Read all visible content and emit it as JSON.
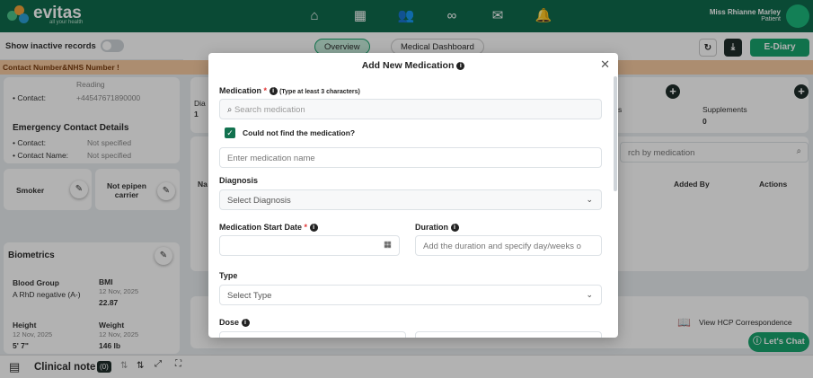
{
  "header": {
    "logo_text": "evitas",
    "logo_tagline": "all your health",
    "user_name": "Miss Rhianne Marley",
    "user_role": "Patient",
    "nav_icons": [
      "home-icon",
      "calendar-icon",
      "people-icon",
      "link-icon",
      "mail-icon",
      "bell-icon"
    ]
  },
  "left": {
    "show_inactive_label": "Show inactive records",
    "banner": "Contact Number&NHS Number !",
    "reading_label": "Reading",
    "contact_label": "• Contact:",
    "contact_value": "+44547671890000",
    "emergency_title": "Emergency Contact Details",
    "emergency_contact_label": "• Contact:",
    "emergency_contact_value": "Not specified",
    "emergency_name_label": "• Contact Name:",
    "emergency_name_value": "Not specified",
    "smoker": "Smoker",
    "epipen": "Not epipen carrier",
    "biometrics_title": "Biometrics",
    "blood_group_label": "Blood Group",
    "blood_group_value": "A RhD negative (A-)",
    "bmi_label": "BMI",
    "bmi_date": "12 Nov, 2025",
    "bmi_value": "22.87",
    "height_label": "Height",
    "height_date": "12 Nov, 2025",
    "height_value": "5' 7\"",
    "weight_label": "Weight",
    "weight_date": "12 Nov, 2025",
    "weight_value": "146 lb"
  },
  "main": {
    "tab_overview": "Overview",
    "tab_dashboard": "Medical Dashboard",
    "ediary": "E-Diary",
    "dia_label": "Dia",
    "dia_count": "1",
    "supplements_label": "Supplements",
    "supplements_count": "0",
    "s_label": "s",
    "search_partial": "rch by medication",
    "col_name": "Na",
    "col_added_by": "Added By",
    "col_actions": "Actions",
    "hcp_link": "View HCP Correspondence",
    "chat": "Let's Chat"
  },
  "bottom": {
    "clinical_note": "Clinical note",
    "count": "(0)"
  },
  "modal": {
    "title": "Add New Medication",
    "medication_label": "Medication",
    "medication_note": "(Type at least 3 characters)",
    "search_placeholder": "Search medication",
    "not_found_label": "Could not find the medication?",
    "name_placeholder": "Enter medication name",
    "diagnosis_label": "Diagnosis",
    "diagnosis_placeholder": "Select Diagnosis",
    "start_date_label": "Medication Start Date",
    "duration_label": "Duration",
    "duration_placeholder": "Add the duration and specify day/weeks o",
    "type_label": "Type",
    "type_placeholder": "Select Type",
    "dose_label": "Dose"
  },
  "colors": {
    "brand_green": "#0f6b4c",
    "accent_green": "#18a46d",
    "banner_orange": "#f7caa1",
    "required_red": "#e03131"
  }
}
